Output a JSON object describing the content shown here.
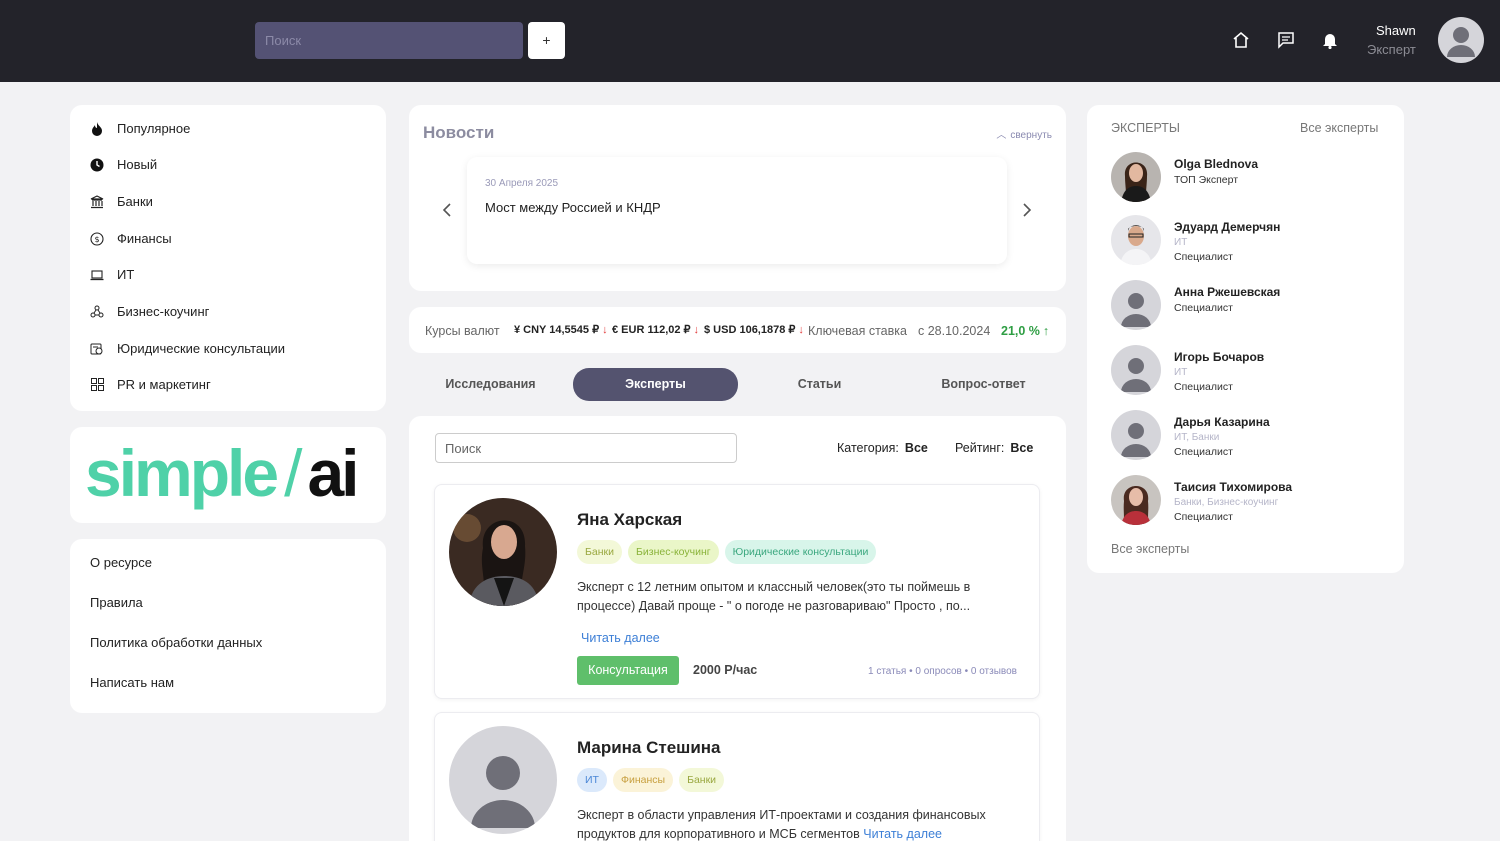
{
  "header": {
    "search_placeholder": "Поиск",
    "plus_label": "+",
    "user_name": "Shawn",
    "user_role": "Эксперт"
  },
  "sidebar": {
    "items": [
      {
        "label": "Популярное",
        "icon": "fire-icon"
      },
      {
        "label": "Новый",
        "icon": "clock-icon"
      },
      {
        "label": "Банки",
        "icon": "bank-icon"
      },
      {
        "label": "Финансы",
        "icon": "dollar-coin-icon"
      },
      {
        "label": "ИТ",
        "icon": "laptop-icon"
      },
      {
        "label": "Бизнес-коучинг",
        "icon": "network-icon"
      },
      {
        "label": "Юридические консультации",
        "icon": "legal-icon"
      },
      {
        "label": "PR и маркетинг",
        "icon": "grid-icon"
      }
    ],
    "logo": {
      "left": "simple",
      "slash": "/",
      "right": "ai"
    },
    "links": [
      "О ресурсе",
      "Правила",
      "Политика обработки данных",
      "Написать нам"
    ]
  },
  "news": {
    "title": "Новости",
    "collapse_label": "свернуть",
    "item_date": "30 Апреля 2025",
    "item_title": "Мост между Россией и КНДР"
  },
  "rates": {
    "label": "Курсы валют",
    "cny": "¥ CNY 14,5545 ₽",
    "eur": "€ EUR 112,02 ₽",
    "usd": "$ USD 106,1878 ₽",
    "down_arrow": "↓",
    "key_rate_label": "Ключевая ставка",
    "key_rate_date": "с 28.10.2024",
    "key_rate_value": "21,0 %",
    "up_arrow": "↑"
  },
  "tabs": [
    {
      "label": "Исследования",
      "active": false
    },
    {
      "label": "Эксперты",
      "active": true
    },
    {
      "label": "Статьи",
      "active": false
    },
    {
      "label": "Вопрос-ответ",
      "active": false
    }
  ],
  "filters": {
    "search_placeholder": "Поиск",
    "category_label": "Категория:",
    "category_value": "Все",
    "rating_label": "Рейтинг:",
    "rating_value": "Все"
  },
  "experts": [
    {
      "name": "Яна Харская",
      "tags": [
        "Банки",
        "Бизнес-коучинг",
        "Юридические консультации"
      ],
      "description": "Эксперт с 12 летним опытом и классный человек(это ты поймешь в процессе) Давай проще - \" о погоде не разговариваю\" Просто , по...",
      "read_more": "Читать далее",
      "consult_label": "Консультация",
      "price": "2000 Р/час",
      "stats": "1 статья • 0 опросов • 0 отзывов"
    },
    {
      "name": "Марина Стешина",
      "tags": [
        "ИТ",
        "Финансы",
        "Банки"
      ],
      "description": "Эксперт в области управления ИТ-проектами и создания финансовых продуктов для корпоративного и МСБ сегментов",
      "read_more": "Читать далее"
    }
  ],
  "experts_panel": {
    "title": "ЭКСПЕРТЫ",
    "all_link": "Все эксперты",
    "footer_link": "Все эксперты",
    "items": [
      {
        "name": "Olga Blednova",
        "sub": "",
        "role": "ТОП Эксперт"
      },
      {
        "name": "Эдуард Демерчян",
        "sub": "ИТ",
        "role": "Специалист"
      },
      {
        "name": "Анна Ржешевская",
        "sub": "",
        "role": "Специалист"
      },
      {
        "name": "Игорь Бочаров",
        "sub": "ИТ",
        "role": "Специалист"
      },
      {
        "name": "Дарья Казарина",
        "sub": "ИТ, Банки",
        "role": "Специалист"
      },
      {
        "name": "Таисия Тихомирова",
        "sub": "Банки, Бизнес-коучинг",
        "role": "Специалист"
      }
    ]
  },
  "colors": {
    "topbar": "#23232a",
    "accent": "#54536f",
    "logo_green": "#4fd1a8",
    "rate_down": "#e23b3b",
    "rate_up": "#2f9e44",
    "consult_green": "#5fbf6b",
    "link_blue": "#3d7fd6"
  }
}
